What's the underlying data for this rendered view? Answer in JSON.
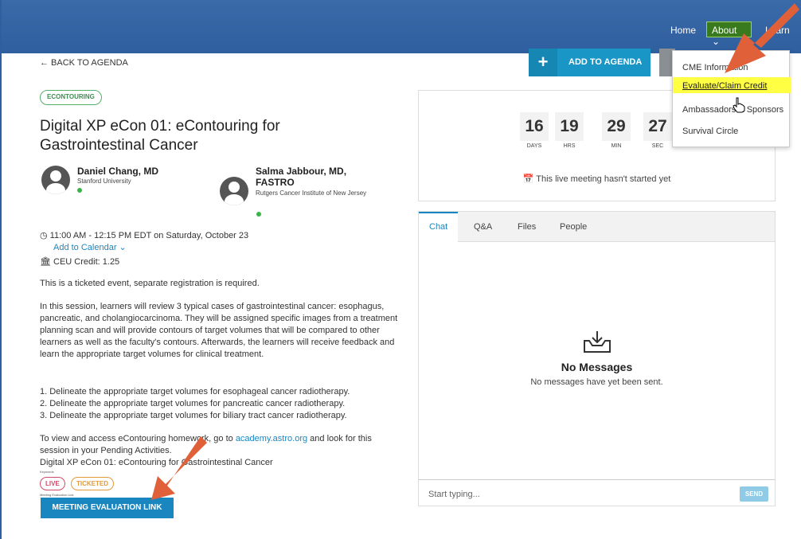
{
  "nav": {
    "home": "Home",
    "about": "About ⌄",
    "learn": "Learn"
  },
  "dropdown": {
    "items": [
      "CME Information",
      "Evaluate/Claim Credit",
      "Ambassadors & Sponsors",
      "Survival Circle"
    ]
  },
  "back_label": "← BACK TO AGENDA",
  "add_to_agenda": "ADD TO AGENDA",
  "tag": "ECONTOURING",
  "title": "Digital XP eCon 01: eContouring for Gastrointestinal Cancer",
  "speakers": [
    {
      "name": "Daniel Chang, MD",
      "institution": "Stanford University"
    },
    {
      "name": "Salma Jabbour, MD, FASTRO",
      "institution": "Rutgers Cancer Institute of New Jersey"
    }
  ],
  "time": "11:00 AM - 12:15 PM EDT on Saturday, October 23",
  "add_calendar": "Add to Calendar ⌄",
  "ceu": "CEU Credit: 1.25",
  "ticketed_note": "This is a ticketed event, separate registration is required.",
  "description": "In this session, learners will review 3 typical cases of gastrointestinal cancer: esophagus, pancreatic, and cholangiocarcinoma. They will be assigned specific images from a treatment planning scan and will provide contours of target volumes that will be compared to other learners as well as the faculty's contours. Afterwards, the learners will receive feedback and learn the appropriate target volumes for clinical treatment.",
  "objectives": [
    "1. Delineate the appropriate target volumes for esophageal cancer radiotherapy.",
    "2. Delineate the appropriate target volumes for pancreatic cancer radiotherapy.",
    "3. Delineate the appropriate target volumes for biliary tract cancer radiotherapy."
  ],
  "homework": {
    "pre": "To view and access eContouring homework, go to ",
    "link": "academy.astro.org",
    "post": " and look for this session in your Pending Activities."
  },
  "session_name": "Digital XP eCon 01: eContouring for Gastrointestinal Cancer",
  "keywords_label": "Keywords",
  "pills": {
    "live": "LIVE",
    "ticketed": "TICKETED"
  },
  "eval_label_small": "Meeting Evaluation Link",
  "meeting_eval_button": "MEETING EVALUATION LINK",
  "countdown": [
    {
      "value": "16",
      "label": "DAYS"
    },
    {
      "value": "19",
      "label": "HRS"
    },
    {
      "value": "29",
      "label": "MIN"
    },
    {
      "value": "27",
      "label": "SEC"
    }
  ],
  "not_started": "This live meeting hasn't started yet",
  "chat_tabs": [
    "Chat",
    "Q&A",
    "Files",
    "People"
  ],
  "no_messages_title": "No Messages",
  "no_messages_sub": "No messages have yet been sent.",
  "chat_placeholder": "Start typing...",
  "send": "SEND",
  "colors": {
    "header": "#3465a4",
    "accent": "#1a86c0",
    "annotation_arrow": "#e0603a",
    "highlight": "#ffff44"
  }
}
